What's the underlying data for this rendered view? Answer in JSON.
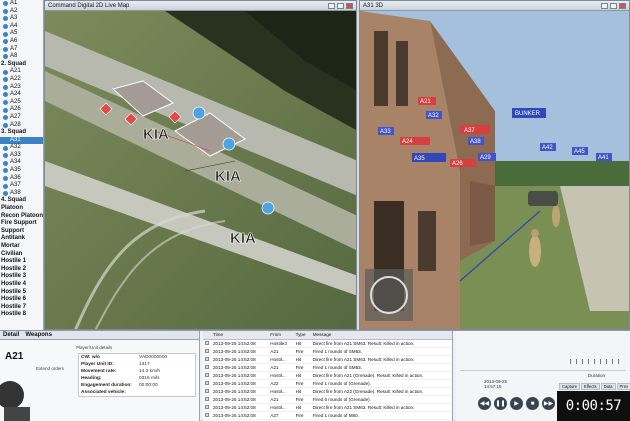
{
  "tree": {
    "items": [
      {
        "label": "A1",
        "kind": "unit"
      },
      {
        "label": "A2",
        "kind": "unit"
      },
      {
        "label": "A3",
        "kind": "unit"
      },
      {
        "label": "A4",
        "kind": "unit"
      },
      {
        "label": "A5",
        "kind": "unit"
      },
      {
        "label": "A6",
        "kind": "unit"
      },
      {
        "label": "A7",
        "kind": "unit"
      },
      {
        "label": "A8",
        "kind": "unit"
      },
      {
        "label": "2. Squad",
        "kind": "group"
      },
      {
        "label": "A21",
        "kind": "unit"
      },
      {
        "label": "A22",
        "kind": "unit"
      },
      {
        "label": "A23",
        "kind": "unit"
      },
      {
        "label": "A24",
        "kind": "unit"
      },
      {
        "label": "A25",
        "kind": "unit"
      },
      {
        "label": "A26",
        "kind": "unit"
      },
      {
        "label": "A27",
        "kind": "unit"
      },
      {
        "label": "A28",
        "kind": "unit"
      },
      {
        "label": "3. Squad",
        "kind": "group"
      },
      {
        "label": "A31",
        "kind": "unit",
        "selected": true
      },
      {
        "label": "A32",
        "kind": "unit"
      },
      {
        "label": "A33",
        "kind": "unit"
      },
      {
        "label": "A34",
        "kind": "unit"
      },
      {
        "label": "A35",
        "kind": "unit"
      },
      {
        "label": "A36",
        "kind": "unit"
      },
      {
        "label": "A37",
        "kind": "unit"
      },
      {
        "label": "A38",
        "kind": "unit"
      },
      {
        "label": "4. Squad",
        "kind": "group"
      },
      {
        "label": "Platoon",
        "kind": "group"
      },
      {
        "label": "Recon Platoon",
        "kind": "group"
      },
      {
        "label": "Fire Support",
        "kind": "group"
      },
      {
        "label": "Support",
        "kind": "group"
      },
      {
        "label": "Antitank",
        "kind": "group"
      },
      {
        "label": "Mortar",
        "kind": "group"
      },
      {
        "label": "Civilian",
        "kind": "group"
      },
      {
        "label": "Hostile 1",
        "kind": "group"
      },
      {
        "label": "Hostile 2",
        "kind": "group"
      },
      {
        "label": "Hostile 3",
        "kind": "group"
      },
      {
        "label": "Hostile 4",
        "kind": "group"
      },
      {
        "label": "Hostile 5",
        "kind": "group"
      },
      {
        "label": "Hostile 6",
        "kind": "group"
      },
      {
        "label": "Hostile 7",
        "kind": "group"
      },
      {
        "label": "Hostile 8",
        "kind": "group"
      }
    ]
  },
  "map2d": {
    "title": "Command Digital 2D Live Map",
    "markers": [
      {
        "label": "KIA"
      },
      {
        "label": "KIA"
      },
      {
        "label": "KIA"
      }
    ]
  },
  "view3d": {
    "title": "A31 3D",
    "labels": [
      "A21",
      "A32",
      "A33",
      "A24",
      "A35",
      "A26",
      "A37",
      "A38",
      "A29",
      "BUNKER",
      "A42",
      "A45",
      "A41"
    ]
  },
  "detail": {
    "tabs": [
      "Detail",
      "Weapons"
    ],
    "unit_name": "A21",
    "player_label": "Player/Unit details",
    "extend_label": "Extend orders",
    "stats": [
      {
        "k": "CW: w/o",
        "v": "VAD0000000"
      },
      {
        "k": "Player Unit ID:",
        "v": "1317"
      },
      {
        "k": "Movement rate:",
        "v": "14.3 km/h"
      },
      {
        "k": "Heading:",
        "v": "0316 mils"
      },
      {
        "k": "Engagement duration:",
        "v": "00:00:00"
      },
      {
        "k": "Associated vehicle:",
        "v": ""
      }
    ]
  },
  "log": {
    "headers": [
      "",
      "Time",
      "From",
      "Type",
      "Message"
    ],
    "rows": [
      [
        "2013-09-25 14:52:08",
        "Hostile3",
        "Hit",
        "Direct fire from A21 SM63. Result: Killed in action."
      ],
      [
        "2013-09-25 14:52:08",
        "A21",
        "Fire",
        "Fired 1 rounds of SM63."
      ],
      [
        "2013-09-25 14:52:08",
        "Hostil...",
        "Hit",
        "Direct fire from A21 SM63. Result: Killed in action."
      ],
      [
        "2013-09-25 14:52:08",
        "A21",
        "Fire",
        "Fired 1 rounds of SM63."
      ],
      [
        "2013-09-25 14:52:08",
        "Hostil...",
        "Hit",
        "Direct fire from A21 (Grenade). Result: Killed in action."
      ],
      [
        "2013-09-25 14:52:08",
        "A22",
        "Fire",
        "Fired 1 rounds of (Grenade)."
      ],
      [
        "2013-09-25 14:52:08",
        "Hostil...",
        "Hit",
        "Direct fire from A22 (Grenade). Result: Killed in action."
      ],
      [
        "2013-09-25 14:52:08",
        "A21",
        "Fire",
        "Fired 5 rounds of (Grenade)."
      ],
      [
        "2013-09-25 14:52:08",
        "Hostil...",
        "Hit",
        "Direct fire from A21 SM63. Result: Killed in action."
      ],
      [
        "2013-09-25 14:52:08",
        "A27",
        "Fire",
        "Fired 1 rounds of M80."
      ],
      [
        "2013-09-25 14:52:08",
        "Hostil...",
        "Hit",
        "Direct fire from Hostile 51 M80. Result: Killed in action."
      ]
    ]
  },
  "player": {
    "date": "2013-09-25",
    "time": "14:57:15",
    "duration_label": "Duration",
    "tabs": [
      "Capture",
      "Effects",
      "Data",
      "Prev",
      "Next"
    ],
    "elapsed": "0:00:57",
    "buttons": {
      "play": "▶",
      "pause": "❚❚",
      "stop": "■",
      "rew": "◀◀",
      "fwd": "▶▶"
    }
  },
  "colors": {
    "friendly": "#3b83c4",
    "hostile": "#e24b4b",
    "kia": "#111111",
    "ui": "#d9dde3"
  }
}
